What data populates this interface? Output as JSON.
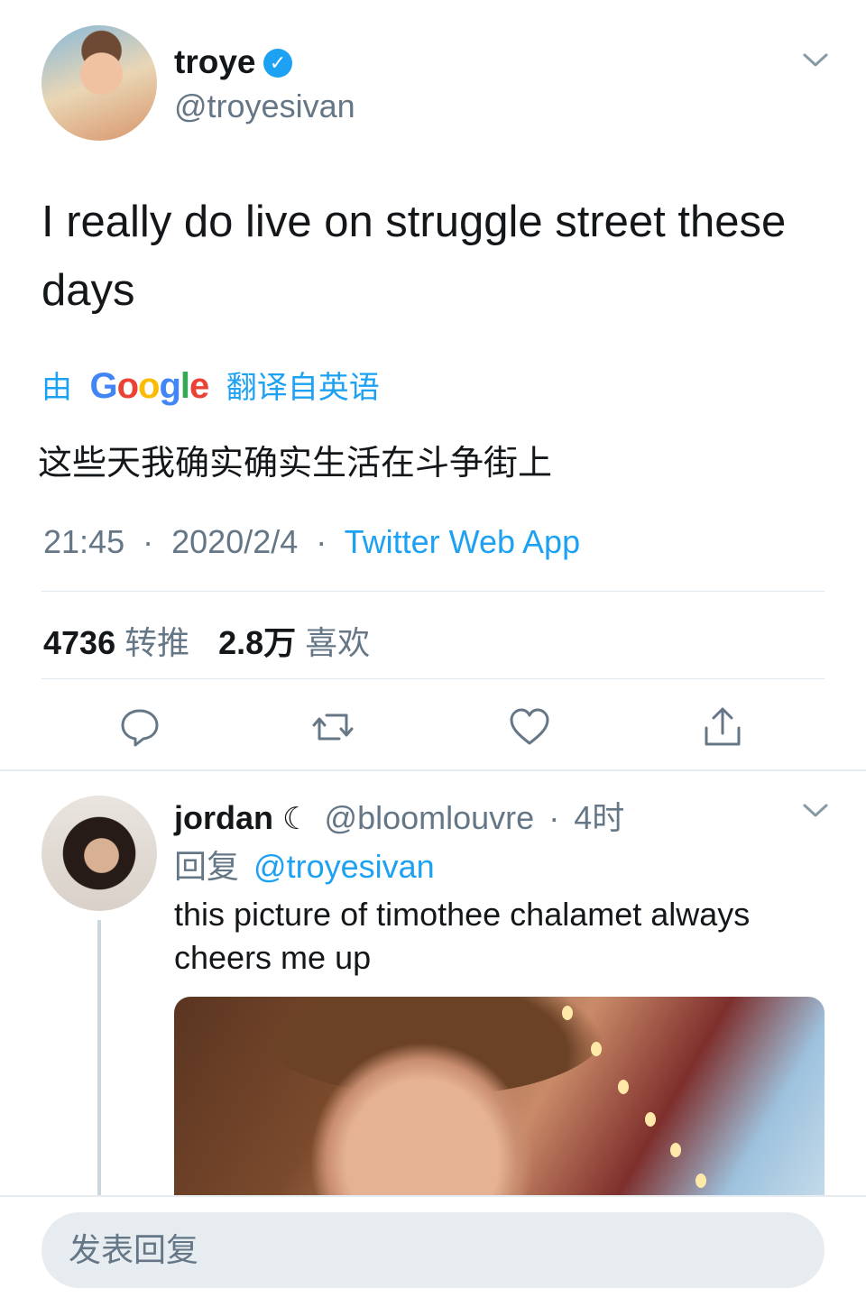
{
  "tweet": {
    "author_name": "troye",
    "verified_glyph": "✓",
    "author_handle": "@troyesivan",
    "text": "I really do live on struggle street these days",
    "translation": {
      "prefix": "由",
      "provider": "Google",
      "suffix": "翻译自英语",
      "text": "这些天我确实确实生活在斗争街上"
    },
    "time": "21:45",
    "date": "2020/2/4",
    "source": "Twitter Web App",
    "separator": "·",
    "stats": {
      "retweets_count": "4736",
      "retweets_label": "转推",
      "likes_count": "2.8万",
      "likes_label": "喜欢"
    },
    "actions": [
      {
        "name": "reply-icon"
      },
      {
        "name": "retweet-icon"
      },
      {
        "name": "like-icon"
      },
      {
        "name": "share-icon"
      }
    ]
  },
  "reply": {
    "author_name": "jordan",
    "moon_glyph": "☾",
    "author_handle": "@bloomlouvre",
    "separator": "·",
    "time": "4时",
    "replying_prefix": "回复",
    "replying_to": "@troyesivan",
    "text": "this picture of timothee chalamet always cheers me up"
  },
  "composer": {
    "placeholder": "发表回复"
  },
  "colors": {
    "link": "#1da1f2",
    "secondary_text": "#657786",
    "primary_text": "#14171a",
    "divider": "#e1e8ed",
    "input_bg": "#e6ecf0"
  }
}
